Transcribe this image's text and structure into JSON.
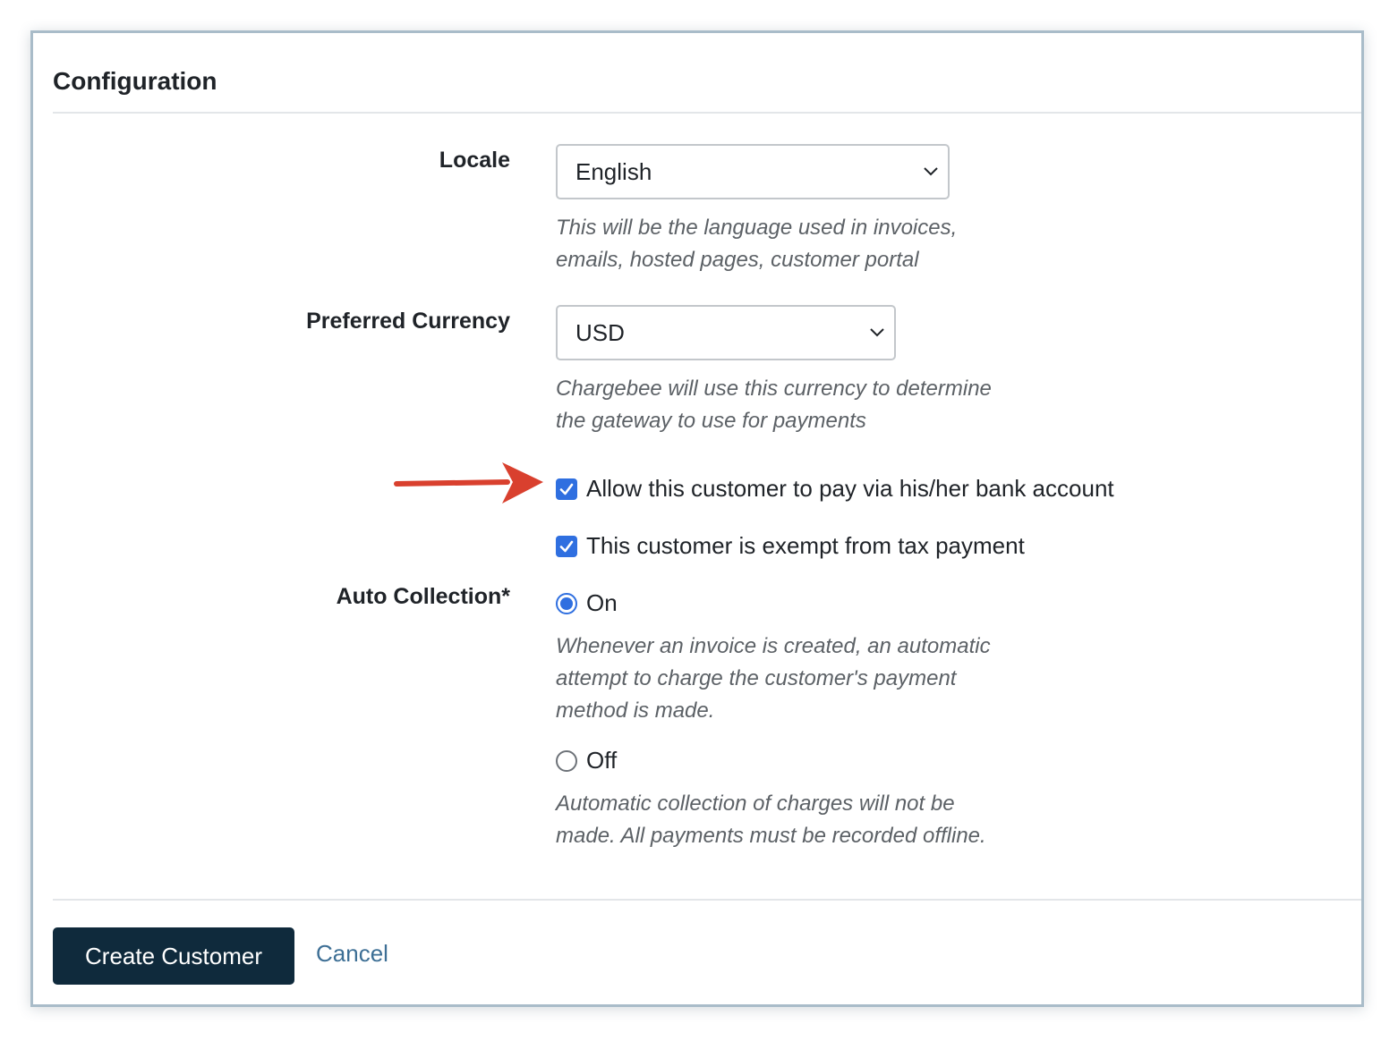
{
  "section": {
    "title": "Configuration"
  },
  "locale": {
    "label": "Locale",
    "value": "English",
    "help_line1": "This will be the language used in invoices,",
    "help_line2": "emails, hosted pages, customer portal"
  },
  "currency": {
    "label": "Preferred Currency",
    "value": "USD",
    "help_line1": "Chargebee will use this currency to determine",
    "help_line2": "the gateway to use for payments"
  },
  "checkboxes": {
    "bank_account": {
      "label": "Allow this customer to pay via his/her bank account",
      "checked": true
    },
    "tax_exempt": {
      "label": "This customer is exempt from tax payment",
      "checked": true
    }
  },
  "auto_collection": {
    "label": "Auto Collection*",
    "on": {
      "label": "On",
      "selected": true,
      "help_line1": "Whenever an invoice is created, an automatic",
      "help_line2": "attempt to charge the customer's payment",
      "help_line3": "method is made."
    },
    "off": {
      "label": "Off",
      "selected": false,
      "help_line1": "Automatic collection of charges will not be",
      "help_line2": "made. All payments must be recorded offline."
    }
  },
  "actions": {
    "create_label": "Create Customer",
    "cancel_label": "Cancel"
  },
  "annotation": {
    "arrow_color": "#d9402e",
    "arrow_icon": "arrow-right-icon"
  },
  "colors": {
    "accent": "#2f6fe0",
    "primary_button": "#0f2a3c",
    "link": "#3d6f95",
    "frame_border": "#a9bcc9"
  }
}
